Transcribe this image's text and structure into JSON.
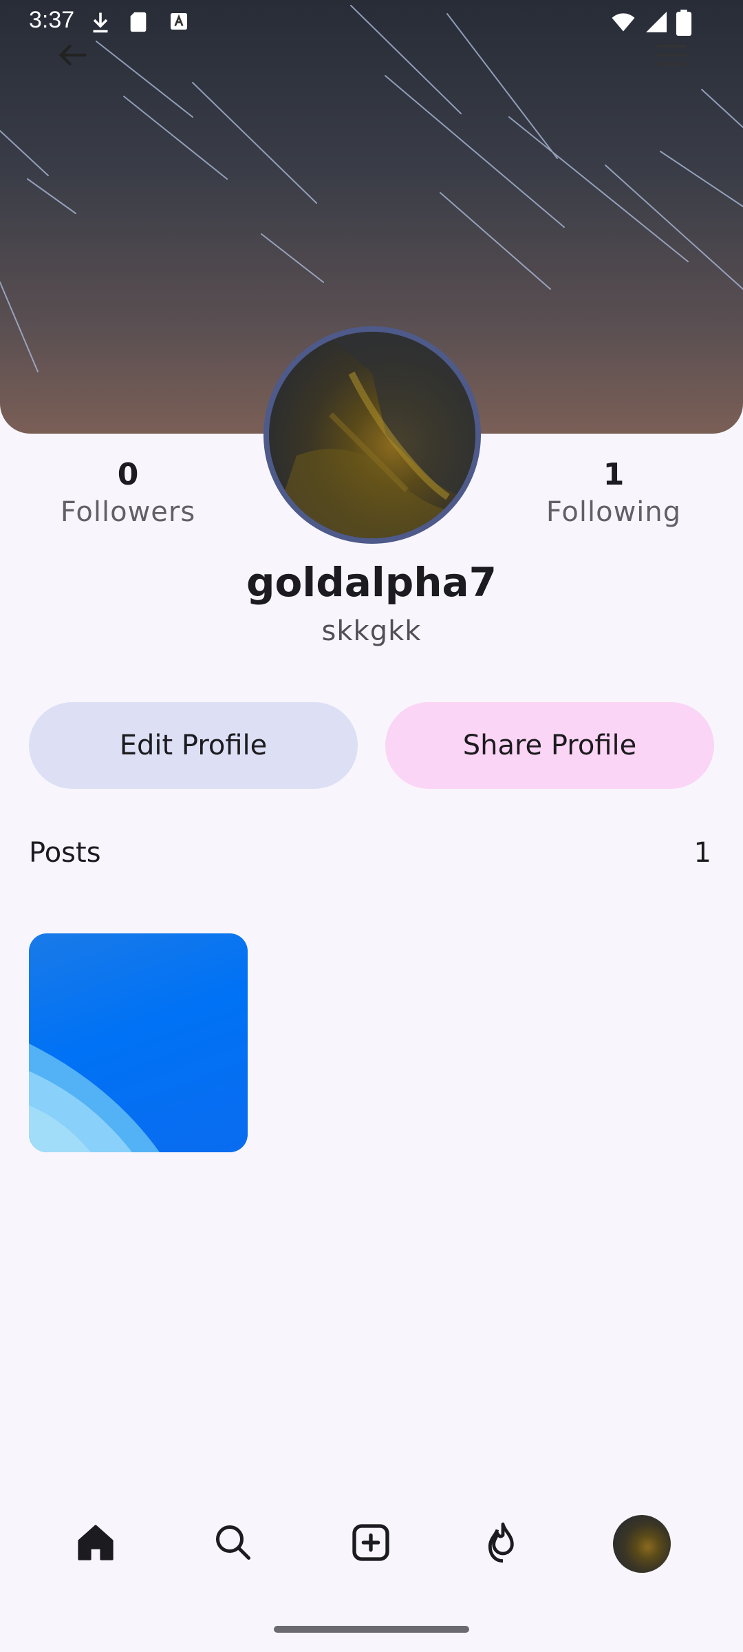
{
  "status_bar": {
    "time": "3:37",
    "icons": [
      "download-icon",
      "sd-card-icon",
      "keyboard-a-icon",
      "wifi-icon",
      "signal-icon",
      "battery-icon"
    ]
  },
  "header": {
    "back_icon": "arrow-left-icon",
    "menu_icon": "hamburger-menu-icon"
  },
  "profile": {
    "followers_count": "0",
    "followers_label": "Followers",
    "following_count": "1",
    "following_label": "Following",
    "username": "goldalpha7",
    "handle": "skkgkk"
  },
  "actions": {
    "edit_label": "Edit Profile",
    "share_label": "Share Profile"
  },
  "posts": {
    "label": "Posts",
    "count": "1"
  },
  "bottom_nav": {
    "items": [
      "home-icon",
      "search-icon",
      "add-post-icon",
      "fire-icon",
      "profile-avatar"
    ]
  },
  "colors": {
    "background": "#f8f6fc",
    "edit_button": "#dde0f5",
    "share_button": "#fbd5f5",
    "avatar_border": "#4e5a8a"
  }
}
